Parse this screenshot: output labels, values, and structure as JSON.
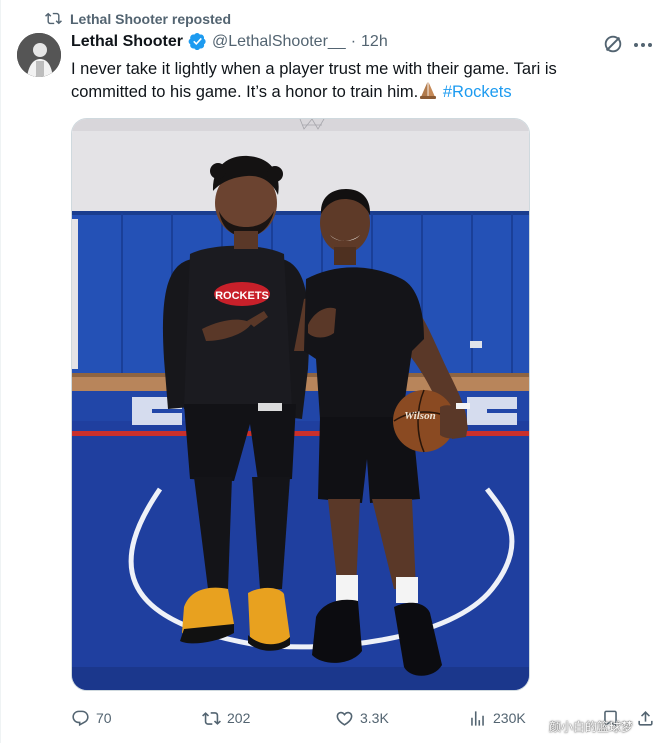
{
  "repost": {
    "text": "Lethal Shooter reposted"
  },
  "author": {
    "name": "Lethal Shooter",
    "handle": "@LethalShooter__",
    "separator": "·",
    "time": "12h"
  },
  "post": {
    "text": "I never take it lightly when a player trust me with their game. Tari is committed to his game. It’s a honor to train him.",
    "hashtag": "#Rockets"
  },
  "media": {
    "shirt_text": "ROCKETS",
    "ball_text": "Wilson"
  },
  "actions": {
    "replies": "70",
    "reposts": "202",
    "likes": "3.3K",
    "views": "230K"
  },
  "watermark": "颜小白的篮球梦",
  "colors": {
    "accent": "#1d9bf0",
    "secondary_text": "#536471",
    "court_blue": "#1e3fa0",
    "wall_blue": "#1f4fb4"
  },
  "icons": [
    "repost-icon",
    "verified-badge-icon",
    "grok-icon",
    "more-icon",
    "folded-hands-emoji",
    "reply-icon",
    "like-icon",
    "views-icon",
    "bookmark-icon",
    "share-icon"
  ]
}
